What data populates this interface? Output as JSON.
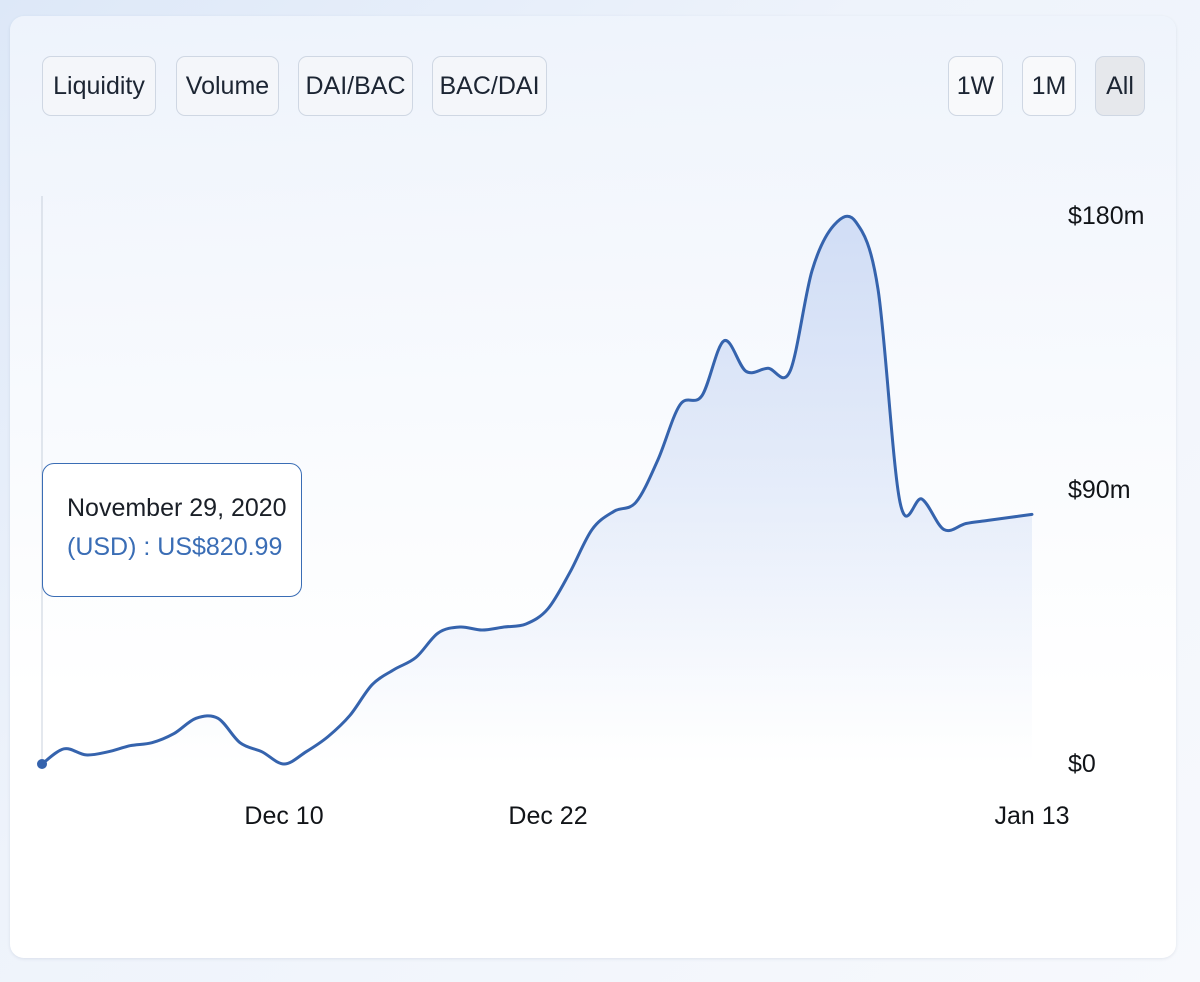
{
  "metric_buttons": [
    "Liquidity",
    "Volume",
    "DAI/BAC",
    "BAC/DAI"
  ],
  "range_buttons": [
    "1W",
    "1M",
    "All"
  ],
  "active_range": "All",
  "tooltip": {
    "date": "November 29, 2020",
    "value": "(USD) : US$820.99"
  },
  "colors": {
    "line": "#3563ad",
    "fill": "#cfdcf5",
    "tooltip_border": "#3a6db5",
    "accent_text": "#3a6db5"
  },
  "chart_data": {
    "type": "area",
    "title": "",
    "xlabel": "",
    "ylabel": "",
    "x_tick_labels": [
      "Dec 10",
      "Dec 22",
      "Jan 13"
    ],
    "x_tick_dates": [
      "2020-12-10",
      "2020-12-22",
      "2021-01-13"
    ],
    "y_tick_labels": [
      "$180m",
      "$90m",
      "$0"
    ],
    "y_tick_values": [
      180,
      90,
      0
    ],
    "ylim": [
      0,
      185
    ],
    "xlim": [
      "2020-11-29",
      "2021-01-13"
    ],
    "unit": "USD millions",
    "grid": false,
    "y_axis_position": "right",
    "series": [
      {
        "dates": [
          "2020-11-29",
          "2020-11-30",
          "2020-12-01",
          "2020-12-02",
          "2020-12-03",
          "2020-12-04",
          "2020-12-05",
          "2020-12-06",
          "2020-12-07",
          "2020-12-08",
          "2020-12-09",
          "2020-12-10",
          "2020-12-11",
          "2020-12-12",
          "2020-12-13",
          "2020-12-14",
          "2020-12-15",
          "2020-12-16",
          "2020-12-17",
          "2020-12-18",
          "2020-12-19",
          "2020-12-20",
          "2020-12-21",
          "2020-12-22",
          "2020-12-23",
          "2020-12-24",
          "2020-12-25",
          "2020-12-26",
          "2020-12-27",
          "2020-12-28",
          "2020-12-29",
          "2020-12-30",
          "2020-12-31",
          "2021-01-01",
          "2021-01-02",
          "2021-01-03",
          "2021-01-04",
          "2021-01-05",
          "2021-01-06",
          "2021-01-07",
          "2021-01-08",
          "2021-01-09",
          "2021-01-10",
          "2021-01-11",
          "2021-01-12",
          "2021-01-13"
        ],
        "values": [
          0,
          5,
          3,
          4,
          6,
          7,
          10,
          15,
          15,
          7,
          4,
          0,
          4,
          9,
          16,
          26,
          31,
          35,
          43,
          45,
          44,
          45,
          46,
          51,
          63,
          77,
          83,
          86,
          100,
          118,
          121,
          139,
          129,
          130,
          129,
          162,
          177,
          178,
          156,
          86,
          87,
          77,
          79,
          80,
          81,
          82
        ]
      }
    ]
  }
}
